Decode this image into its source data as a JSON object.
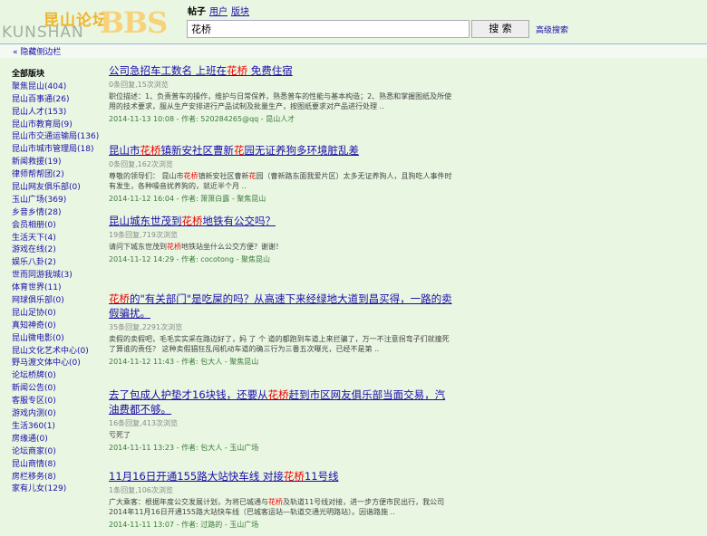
{
  "logo": {
    "cn": "昆山论坛",
    "en": "KUNSHAN",
    "bbs": "BBS"
  },
  "search": {
    "tabs": [
      {
        "label": "帖子",
        "current": true
      },
      {
        "label": "用户",
        "current": false
      },
      {
        "label": "版块",
        "current": false
      }
    ],
    "query": "花桥",
    "button": "搜 索",
    "advanced": "高级搜索"
  },
  "hide_sidebar": "« 隐藏侧边栏",
  "sidebar": {
    "title": "全部版块",
    "items": [
      {
        "name": "聚焦昆山",
        "count": "(404)"
      },
      {
        "name": "昆山百事通",
        "count": "(26)"
      },
      {
        "name": "昆山人才",
        "count": "(153)"
      },
      {
        "name": "昆山市教育局",
        "count": "(9)"
      },
      {
        "name": "昆山市交通运输局",
        "count": "(136)"
      },
      {
        "name": "昆山市城市管理局",
        "count": "(18)"
      },
      {
        "name": "新闻救援",
        "count": "(19)"
      },
      {
        "name": "律师帮帮团",
        "count": "(2)"
      },
      {
        "name": "昆山网友俱乐部",
        "count": "(0)"
      },
      {
        "name": "玉山广场",
        "count": "(369)"
      },
      {
        "name": "乡音乡情",
        "count": "(28)"
      },
      {
        "name": "会员相册",
        "count": "(0)"
      },
      {
        "name": "生活天下",
        "count": "(4)"
      },
      {
        "name": "游戏在线",
        "count": "(2)"
      },
      {
        "name": "娱乐八卦",
        "count": "(2)"
      },
      {
        "name": "世而同游我城",
        "count": "(3)"
      },
      {
        "name": "体育世界",
        "count": "(11)"
      },
      {
        "name": "网球俱乐部",
        "count": "(0)"
      },
      {
        "name": "昆山足协",
        "count": "(0)"
      },
      {
        "name": "真知神奇",
        "count": "(0)"
      },
      {
        "name": "昆山微电影",
        "count": "(0)"
      },
      {
        "name": "昆山文化艺术中心",
        "count": "(0)"
      },
      {
        "name": "野马渡文体中心",
        "count": "(0)"
      },
      {
        "name": "论坛桥牌",
        "count": "(0)"
      },
      {
        "name": "新闻公告",
        "count": "(0)"
      },
      {
        "name": "客服专区",
        "count": "(0)"
      },
      {
        "name": "游戏内测",
        "count": "(0)"
      },
      {
        "name": "生活360",
        "count": "(1)"
      },
      {
        "name": "房缘通",
        "count": "(0)"
      },
      {
        "name": "论坛商家",
        "count": "(0)"
      },
      {
        "name": "昆山商情",
        "count": "(8)"
      },
      {
        "name": "房栏移务",
        "count": "(8)"
      },
      {
        "name": "家有儿女",
        "count": "(129)"
      }
    ]
  },
  "results": [
    {
      "title": [
        "公司急招车工数名 上班在",
        "花桥",
        " 免费住宿"
      ],
      "meta": "0条回复,15次浏览",
      "snippet": [
        "职位描述：1、负责普车的操作，维护与日常保养，熟悉普车的性能与基本构造；2、熟悉和掌握图纸及所使用的技术要求，服从生产安排进行产品试制及批量生产，按图纸要求对产品进行处理 .."
      ],
      "footer": "2014-11-13 10:08 - 作者: 520284265@qq - 昆山人才"
    },
    {
      "title": [
        "昆山市",
        "花桥",
        "镇新安社区曹新",
        "花",
        "园无证养狗多环境脏乱差"
      ],
      "meta": "0条回复,162次浏览",
      "snippet": [
        "尊敬的领导们：     昆山市",
        "花桥",
        "镇新安社区曹新",
        "花",
        "园（曹新路东面我爱片区）太多无证养狗人，且狗吃人事件时有发生，各种噪音扰养狗的，就近半个月 .."
      ],
      "footer": "2014-11-12 16:04 - 作者: 箫箫白露 - 聚焦昆山"
    },
    {
      "title": [
        "昆山城东世茂到",
        "花桥",
        "地铁有公交吗？"
      ],
      "meta": "19条回复,719次浏览",
      "snippet": [
        "请问下城东世茂到",
        "花桥",
        "地铁站坐什么公交方便？谢谢！"
      ],
      "footer": "2014-11-12 14:29 - 作者: cocotong - 聚焦昆山"
    },
    {
      "title": [
        "花桥",
        "的\"有关部门\"是吃屎的吗？从高速下来经绿地大道到昌买得，一路的卖假骗扰。"
      ],
      "meta": "35条回复,2291次浏览",
      "snippet": [
        "卖假的卖假吧，毛毛实实采在路边好了，妈 了 个 道的都跑到车道上来拦骗了，万一不注意拐弯子们就撞死了算谁的责任？ 这种卖假猖狂乱闯机动车道的确三行为三番五次曝光，已经不是第 .."
      ],
      "footer": "2014-11-12 11:43 - 作者: 包大人 - 聚焦昆山"
    },
    {
      "title": [
        "去了包成人护垫才16块钱，还要从",
        "花桥",
        "赶到市区网友俱乐部当面交易，汽油费都不够。"
      ],
      "meta": "16条回复,413次浏览",
      "snippet": [
        "亏死了"
      ],
      "footer": "2014-11-11 13:23 - 作者: 包大人 - 玉山广场"
    },
    {
      "title": [
        "11月16日开通155路大站快车线 对接",
        "花桥",
        "11号线"
      ],
      "meta": "1条回复,106次浏览",
      "snippet": [
        "广大乘客：根据年度公交发展计划，为将已城通与",
        "花桥",
        "及轨道11号线对接，进一步方便市民出行，我公司2014年11月16日开通155路大站快车线（巴城客运站—轨道交通光明路站）。因谐路施 .."
      ],
      "footer": "2014-11-11 13:07 - 作者: 过路的 - 玉山广场"
    }
  ]
}
